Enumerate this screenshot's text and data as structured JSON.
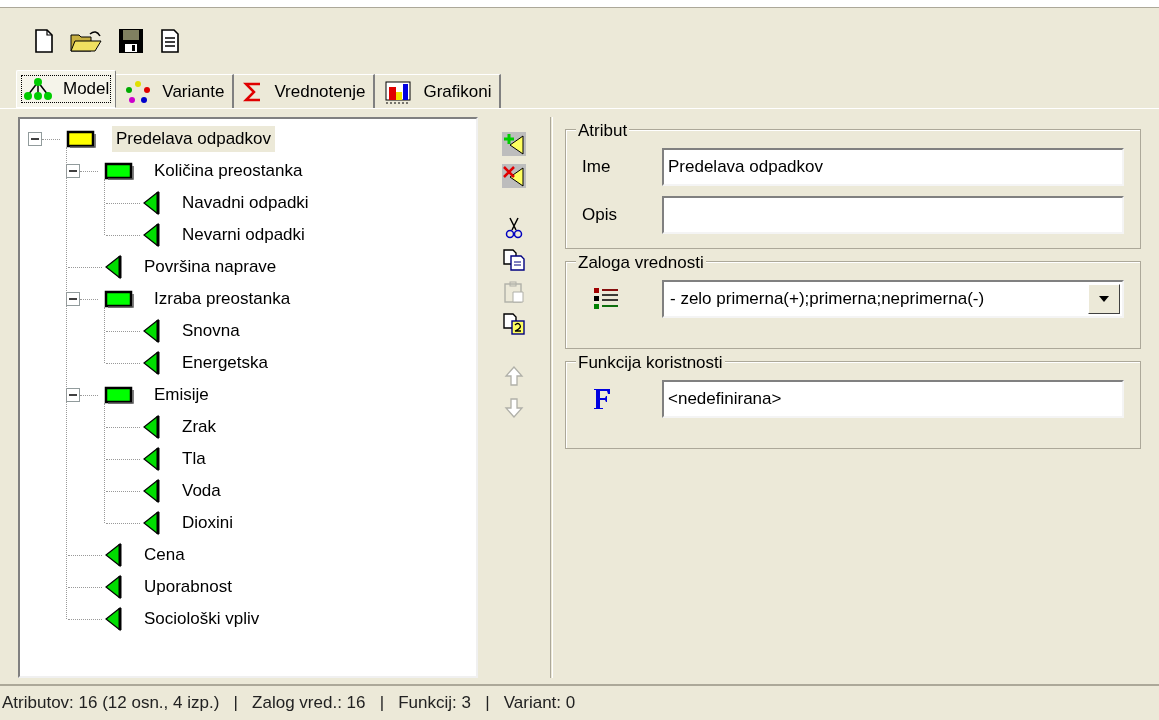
{
  "tabs": [
    {
      "label": "Model",
      "selected": true
    },
    {
      "label": "Variante",
      "selected": false
    },
    {
      "label": "Vrednotenje",
      "selected": false
    },
    {
      "label": "Grafikoni",
      "selected": false
    }
  ],
  "tree": [
    {
      "label": "Predelava odpadkov",
      "kind": "aggregate",
      "color": "#ffff00",
      "expanded": true,
      "selected": true,
      "children": [
        {
          "label": "Količina preostanka",
          "kind": "aggregate",
          "color": "#00ff00",
          "expanded": true,
          "selected": false,
          "children": [
            {
              "label": "Navadni odpadki",
              "kind": "basic",
              "selected": false
            },
            {
              "label": "Nevarni odpadki",
              "kind": "basic",
              "selected": false
            }
          ]
        },
        {
          "label": "Površina naprave",
          "kind": "basic",
          "selected": false
        },
        {
          "label": "Izraba preostanka",
          "kind": "aggregate",
          "color": "#00ff00",
          "expanded": true,
          "selected": false,
          "children": [
            {
              "label": "Snovna",
              "kind": "basic",
              "selected": false
            },
            {
              "label": "Energetska",
              "kind": "basic",
              "selected": false
            }
          ]
        },
        {
          "label": "Emisije",
          "kind": "aggregate",
          "color": "#00ff00",
          "expanded": true,
          "selected": false,
          "children": [
            {
              "label": "Zrak",
              "kind": "basic",
              "selected": false
            },
            {
              "label": "Tla",
              "kind": "basic",
              "selected": false
            },
            {
              "label": "Voda",
              "kind": "basic",
              "selected": false
            },
            {
              "label": "Dioxini",
              "kind": "basic",
              "selected": false
            }
          ]
        },
        {
          "label": "Cena",
          "kind": "basic",
          "selected": false
        },
        {
          "label": "Uporabnost",
          "kind": "basic",
          "selected": false
        },
        {
          "label": "Sociološki vpliv",
          "kind": "basic",
          "selected": false
        }
      ]
    }
  ],
  "side_tools": [
    {
      "kind": "add",
      "disabled": false
    },
    {
      "kind": "delete",
      "disabled": false
    },
    {
      "kind": "cut",
      "disabled": false
    },
    {
      "kind": "copy",
      "disabled": false
    },
    {
      "kind": "paste",
      "disabled": true
    },
    {
      "kind": "copy2",
      "disabled": false
    },
    {
      "kind": "up",
      "disabled": true
    },
    {
      "kind": "down",
      "disabled": true
    }
  ],
  "attribute": {
    "title": "Atribut",
    "name_label": "Ime",
    "name_value": "Predelava odpadkov",
    "description_label": "Opis"
  },
  "value_scale": {
    "title": "Zaloga vrednosti",
    "value": "- zelo primerna(+);primerna;neprimerna(-)"
  },
  "utility_function": {
    "title": "Funkcija koristnosti",
    "value": "<nedefinirana>"
  },
  "status_bar": "Atributov: 16 (12 osn., 4 izp.)   |   Zalog vred.: 16   |   Funkcij: 3   |   Variant: 0"
}
